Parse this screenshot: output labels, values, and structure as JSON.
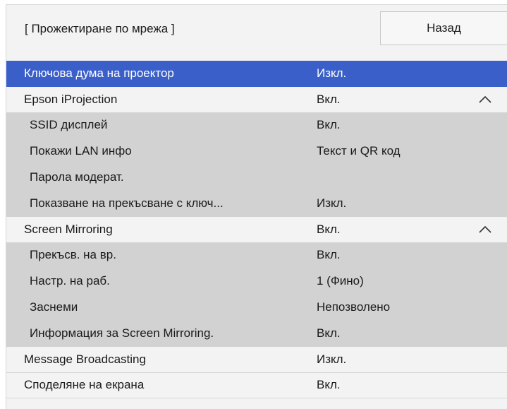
{
  "header": {
    "title": "[ Прожектиране по мрежа ]",
    "back_label": "Назад"
  },
  "menu": [
    {
      "label": "Ключова дума на проектор",
      "value": "Изкл.",
      "level": "top",
      "selected": true
    },
    {
      "label": "Epson iProjection",
      "value": "Вкл.",
      "level": "top",
      "expanded": true
    },
    {
      "label": "SSID дисплей",
      "value": "Вкл.",
      "level": "sub"
    },
    {
      "label": "Покажи LAN инфо",
      "value": "Текст и QR код",
      "level": "sub"
    },
    {
      "label": "Парола модерат.",
      "value": "",
      "level": "sub"
    },
    {
      "label": "Показване на прекъсване с ключ...",
      "value": "Изкл.",
      "level": "sub"
    },
    {
      "label": "Screen Mirroring",
      "value": "Вкл.",
      "level": "top",
      "expanded": true
    },
    {
      "label": "Прекъсв. на вр.",
      "value": "Вкл.",
      "level": "sub"
    },
    {
      "label": "Настр. на раб.",
      "value": "1 (Фино)",
      "level": "sub"
    },
    {
      "label": "Заснеми",
      "value": "Непозволено",
      "level": "sub"
    },
    {
      "label": "Информация за Screen Mirroring.",
      "value": "Вкл.",
      "level": "sub"
    },
    {
      "label": "Message Broadcasting",
      "value": "Изкл.",
      "level": "top"
    },
    {
      "label": "Споделяне на екрана",
      "value": "Вкл.",
      "level": "top"
    }
  ],
  "colors": {
    "selected": "#3b5fc8",
    "submenu_bg": "#d2d2d2",
    "panel_bg": "#f3f3f3"
  },
  "icons": {
    "expanded": "chevron-up-icon"
  }
}
